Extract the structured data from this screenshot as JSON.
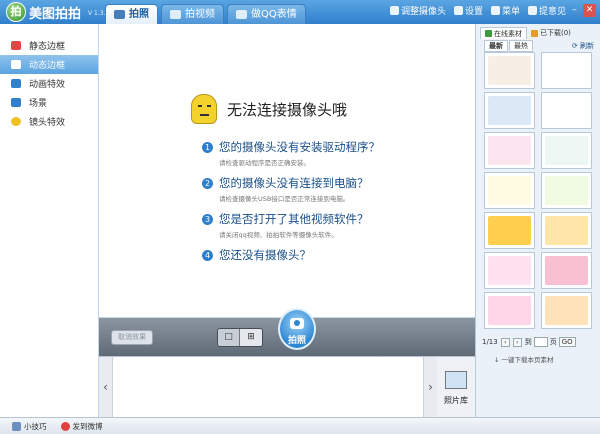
{
  "app": {
    "logo_text": "拍",
    "name": "美图拍拍",
    "version": "V 1.3.7"
  },
  "tabs": [
    {
      "label": "拍照"
    },
    {
      "label": "拍视频"
    },
    {
      "label": "做QQ表情"
    }
  ],
  "title_actions": {
    "camera_settings": "调整摄像头",
    "settings": "设置",
    "menu": "菜单",
    "feedback": "提意见"
  },
  "sidebar": {
    "items": [
      {
        "label": "静态边框",
        "icon": "frame-icon",
        "color": "#e04646"
      },
      {
        "label": "动态边框",
        "icon": "film-icon",
        "color": "#2f7fcc"
      },
      {
        "label": "动画特效",
        "icon": "animation-icon",
        "color": "#2f7fcc"
      },
      {
        "label": "场景",
        "icon": "scene-icon",
        "color": "#2f7fcc"
      },
      {
        "label": "镜头特效",
        "icon": "smiley-icon",
        "color": "#f0c020"
      }
    ]
  },
  "camera_error": {
    "title": "无法连接摄像头哦",
    "reasons": [
      {
        "num": "1",
        "title": "您的摄像头没有安装驱动程序？",
        "detail": "请检查驱动程序是否正确安装。"
      },
      {
        "num": "2",
        "title": "您的摄像头没有连接到电脑？",
        "detail": "请检查摄像头USB接口是否正常连接到电脑。"
      },
      {
        "num": "3",
        "title": "您是否打开了其他视频软件？",
        "detail": "请关闭qq视频、拍拍软件等摄像头软件。"
      },
      {
        "num": "4",
        "title": "您还没有摄像头？",
        "detail": ""
      }
    ]
  },
  "controls": {
    "cancel_effect": "取消效果",
    "single_mode": "□",
    "grid_mode": "⊞",
    "shoot": "拍照"
  },
  "strip": {
    "prev": "‹",
    "next": "›",
    "photo_library": "照片库"
  },
  "right_panel": {
    "tabs": [
      {
        "label": "在线素材"
      },
      {
        "label": "已下载(0)"
      }
    ],
    "subtabs": [
      {
        "label": "最新"
      },
      {
        "label": "最热"
      }
    ],
    "refresh": "刷新",
    "thumbs": [
      "#f7efe6",
      "#ffffff",
      "#dbe9f7",
      "#ffffff",
      "#fbe6ef",
      "#ecf7f3",
      "#fffbe2",
      "#f1fbe2",
      "#ffcf50",
      "#ffe6a8",
      "#ffe2f0",
      "#f8c0d0",
      "#ffd6e8",
      "#ffe2b8"
    ],
    "pager": {
      "page": "1/13",
      "to": "到",
      "unit": "页",
      "go": "GO",
      "prev_btn": "‹",
      "next_btn": "›"
    },
    "download_all": "一键下载本页素材"
  },
  "statusbar": {
    "tips": "小技巧",
    "share": "发到微博"
  }
}
